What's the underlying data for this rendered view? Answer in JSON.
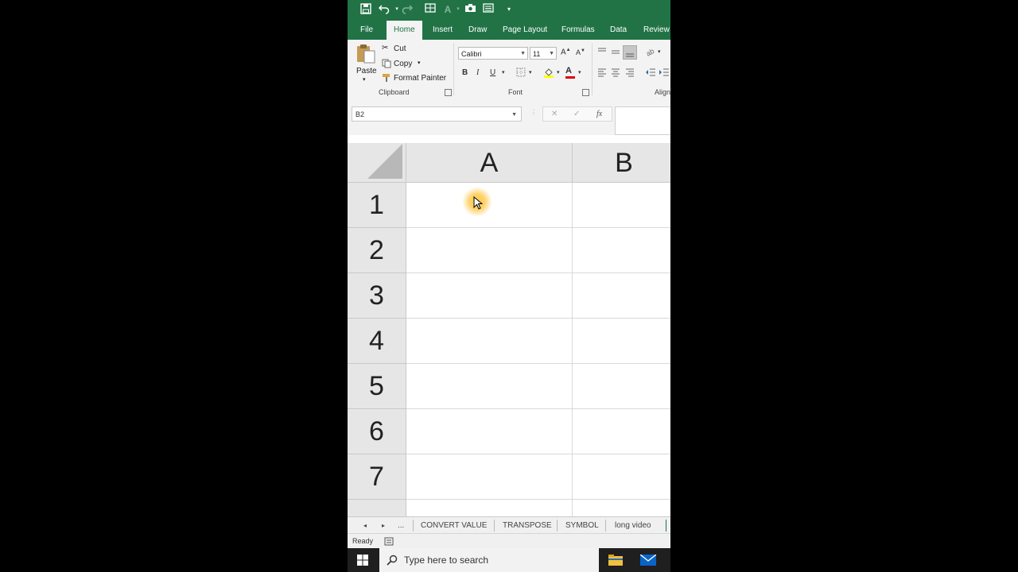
{
  "ribbon_tabs": [
    "File",
    "Home",
    "Insert",
    "Draw",
    "Page Layout",
    "Formulas",
    "Data",
    "Review"
  ],
  "active_tab": "Home",
  "clipboard": {
    "paste": "Paste",
    "cut": "Cut",
    "copy": "Copy",
    "format_painter": "Format Painter",
    "group_label": "Clipboard"
  },
  "font": {
    "name": "Calibri",
    "size": "11",
    "group_label": "Font",
    "bold": "B",
    "italic": "I",
    "underline": "U"
  },
  "alignment": {
    "group_label": "Align"
  },
  "formula_bar": {
    "name_box": "B2",
    "cancel": "✕",
    "enter": "✓",
    "fx": "fx"
  },
  "columns": [
    "A",
    "B"
  ],
  "rows": [
    "1",
    "2",
    "3",
    "4",
    "5",
    "6",
    "7"
  ],
  "sheet_tabs": [
    "CONVERT VALUE",
    "TRANSPOSE",
    "SYMBOL",
    "long video"
  ],
  "sheet_more": "...",
  "status": "Ready",
  "taskbar": {
    "search_placeholder": "Type here to search"
  },
  "colors": {
    "excel_green": "#217346",
    "ribbon_bg": "#f3f3f3",
    "header_bg": "#e6e6e6"
  }
}
